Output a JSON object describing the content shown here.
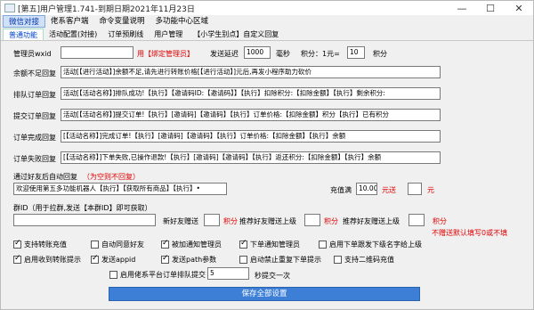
{
  "window": {
    "title": "[第五]用户管理1.741-到期日期2021年11月23日"
  },
  "menu": [
    "微信对接",
    "佬系客户端",
    "命令变量说明",
    "多功能中心区域"
  ],
  "tabs": [
    "普通功能",
    "活动配置(対接)",
    "订单预刷线",
    "用户管理",
    "【小学生别点】自定义回复"
  ],
  "admin": {
    "label": "管理员wxid",
    "value": "",
    "hint": "用【绑定管理员】",
    "delay_label": "发送延迟",
    "delay_value": "1000",
    "ms": "毫秒",
    "points_label": "积分：1元=",
    "points_value": "10",
    "points_unit": "积分"
  },
  "rows": [
    {
      "label": "余额不足回复",
      "value": "活动[【进行活动】]余额不足,请先进行转账价格[【进行活动】]元后,再发小程序助力砍价"
    },
    {
      "label": "排队订单回复",
      "value": "活动[【活动名称】]排队成功!【执行】【邀请码ID:【邀请码】】【执行】扣除积分:【扣除金额】【执行】剩余积分:"
    },
    {
      "label": "提交订单回复",
      "value": "活动[【活动名称】]提交订单!【执行】[邀请码]【邀请码】【执行】订单价格:【扣除金额】积分【执行】已有积分"
    },
    {
      "label": "订单完成回复",
      "value": "[【活动名称】]完成订单!【执行】[邀请码]【邀请码】【执行】订单价格:【扣除金额】【执行】余额"
    },
    {
      "label": "订单失败回复",
      "value": "[【活动名称】]下单失败,已操作退款!【执行】[邀请码]【邀请码】【执行】返还积分:【扣除金额】【执行】余额"
    }
  ],
  "friend": {
    "label": "通过好友后自动回复",
    "hint": "（为空则不回复）",
    "value": "欢迎使用第五多功能机器人【执行】【获取所有商品】【执行】•",
    "charge_label": "充值满",
    "charge_value": "10.00",
    "charge_send": "元送",
    "charge_points": "",
    "charge_unit": "元"
  },
  "group": {
    "label": "群ID（用于拉群,发送【本群ID】即可获取）",
    "value": "",
    "new_friend_label": "新好友赠送",
    "new_friend_value": "",
    "unit": "积分",
    "recommend_label": "推荐好友赠送上级",
    "recommend_value": "",
    "recommend2_label": "推荐好友赠送上级",
    "recommend2_value": "",
    "note": "不赠送默认填写0或不填"
  },
  "checks": [
    {
      "label": "支持转账充值",
      "checked": true
    },
    {
      "label": "自动同意好友",
      "checked": false
    },
    {
      "label": "被加通知管理员",
      "checked": true
    },
    {
      "label": "下单通知管理员",
      "checked": true
    },
    {
      "label": "启用下单跟发下级名字给上级",
      "checked": false
    },
    {
      "label": "启用收到转账提示",
      "checked": true
    },
    {
      "label": "发送appid",
      "checked": true
    },
    {
      "label": "发送path参数",
      "checked": true
    },
    {
      "label": "启动禁止重复下单提示",
      "checked": false
    },
    {
      "label": "支持二维码充值",
      "checked": false
    }
  ],
  "refresh": {
    "label": "启用佬系平台订单排队提交",
    "checked": false,
    "value": "5",
    "suffix": "秒提交一次"
  },
  "save_label": "保存全部设置"
}
